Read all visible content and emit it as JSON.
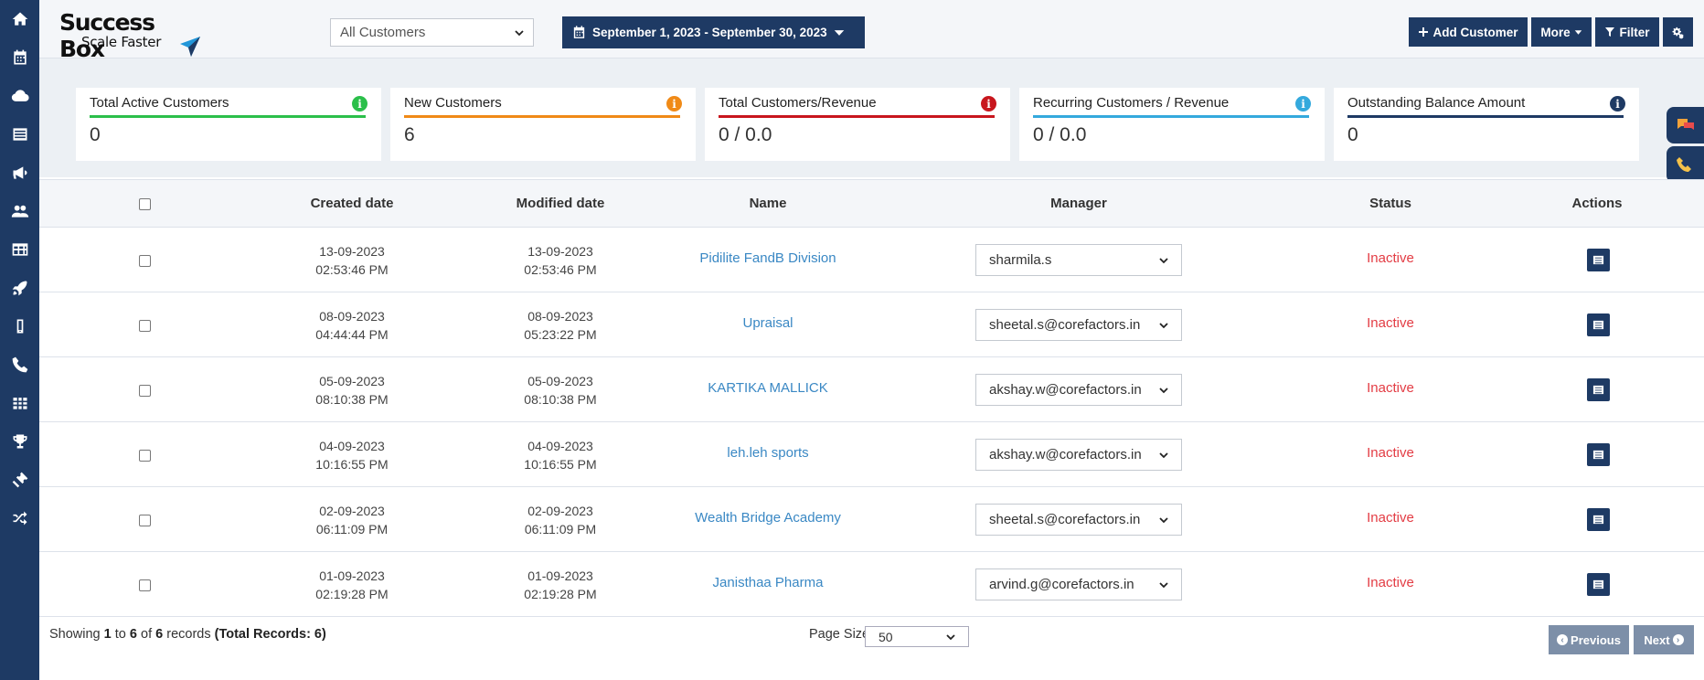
{
  "nav": {
    "icons": [
      "home-icon",
      "calendar-icon",
      "cloud-icon",
      "list-icon",
      "megaphone-icon",
      "users-icon",
      "table-icon",
      "rocket-icon",
      "mobile-icon",
      "phone-icon",
      "grid-icon",
      "trophy-icon",
      "ticket-icon",
      "shuffle-icon"
    ]
  },
  "header": {
    "brand": "Success Box",
    "tagline": "Scale Faster",
    "customer_filter": "All Customers",
    "date_range": "September 1, 2023 - September 30, 2023",
    "add_customer": "Add Customer",
    "more": "More",
    "filter": "Filter"
  },
  "stats": [
    {
      "title": "Total Active Customers",
      "value": "0",
      "color": "#2bbf4a"
    },
    {
      "title": "New Customers",
      "value": "6",
      "color": "#f08a17"
    },
    {
      "title": "Total Customers/Revenue",
      "value": "0 / 0.0",
      "color": "#c8161d"
    },
    {
      "title": "Recurring Customers / Revenue",
      "value": "0 / 0.0",
      "color": "#34a9dd"
    },
    {
      "title": "Outstanding Balance Amount",
      "value": "0",
      "color": "#1e3a64"
    }
  ],
  "table": {
    "headers": {
      "created": "Created date",
      "modified": "Modified date",
      "name": "Name",
      "manager": "Manager",
      "status": "Status",
      "actions": "Actions"
    },
    "rows": [
      {
        "created_date": "13-09-2023",
        "created_time": "02:53:46 PM",
        "modified_date": "13-09-2023",
        "modified_time": "02:53:46 PM",
        "name": "Pidilite FandB Division",
        "manager": "sharmila.s",
        "status": "Inactive"
      },
      {
        "created_date": "08-09-2023",
        "created_time": "04:44:44 PM",
        "modified_date": "08-09-2023",
        "modified_time": "05:23:22 PM",
        "name": "Upraisal",
        "manager": "sheetal.s@corefactors.in",
        "status": "Inactive"
      },
      {
        "created_date": "05-09-2023",
        "created_time": "08:10:38 PM",
        "modified_date": "05-09-2023",
        "modified_time": "08:10:38 PM",
        "name": "KARTIKA MALLICK",
        "manager": "akshay.w@corefactors.in",
        "status": "Inactive"
      },
      {
        "created_date": "04-09-2023",
        "created_time": "10:16:55 PM",
        "modified_date": "04-09-2023",
        "modified_time": "10:16:55 PM",
        "name": "leh.leh sports",
        "manager": "akshay.w@corefactors.in",
        "status": "Inactive"
      },
      {
        "created_date": "02-09-2023",
        "created_time": "06:11:09 PM",
        "modified_date": "02-09-2023",
        "modified_time": "06:11:09 PM",
        "name": "Wealth Bridge Academy",
        "manager": "sheetal.s@corefactors.in",
        "status": "Inactive"
      },
      {
        "created_date": "01-09-2023",
        "created_time": "02:19:28 PM",
        "modified_date": "01-09-2023",
        "modified_time": "02:19:28 PM",
        "name": "Janisthaa Pharma",
        "manager": "arvind.g@corefactors.in",
        "status": "Inactive"
      }
    ]
  },
  "footer": {
    "showing_prefix": "Showing",
    "from": "1",
    "to_word": "to",
    "to": "6",
    "of_word": "of",
    "count": "6",
    "records_word": "records",
    "total": "(Total Records: 6)",
    "page_size_label": "Page Size",
    "page_size": "50",
    "previous": "Previous",
    "next": "Next"
  }
}
